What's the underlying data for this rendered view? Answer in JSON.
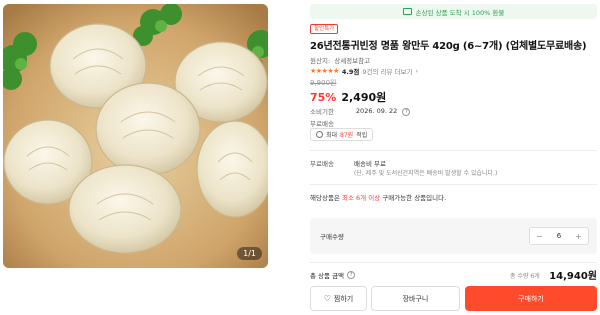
{
  "image": {
    "counter": "1/1"
  },
  "banner": {
    "text": "손상된 상품 도착 시 100% 환불",
    "color": "#2f9f52"
  },
  "product": {
    "badge": "할인특가",
    "title": "26년전통귀빈정 명품 왕만두 420g (6~7개) (업체별도무료배송)",
    "origin_label": "원산지:",
    "origin_value": "상세정보참고",
    "rating": {
      "stars": "★★★★★",
      "score": "4.9점",
      "reviews": "9건의 리뷰 더보기",
      "chevron": "›"
    },
    "original_price": "9,900원",
    "discount": "75%",
    "price": "2,490원",
    "expiry_label": "소비기한",
    "expiry_value": "2026. 09. 22",
    "help_symbol": "?"
  },
  "benefit": {
    "label": "무료배송",
    "coupon_prefix": "최대",
    "coupon_highlight": "87원",
    "coupon_suffix": "적립"
  },
  "shipping": {
    "label": "무료배송",
    "value": "배송비 무료",
    "note": "(단, 제주 및 도서산간지역은 배송비 발생할 수 있습니다.)"
  },
  "bundle": {
    "prefix": "해당상품은",
    "highlight": "최소 6개 이상",
    "suffix": "구매가능한 상품입니다."
  },
  "quantity": {
    "label": "구매수량",
    "value": "6",
    "minus": "−",
    "plus": "+"
  },
  "total": {
    "label": "총 상품 금액",
    "help_symbol": "?",
    "count": "총 수량 6개",
    "price": "14,940원"
  },
  "actions": {
    "wish_label": "찜하기",
    "cart_label": "장바구니",
    "buy_label": "구매하기"
  },
  "colors": {
    "accent": "#ff4a2b",
    "discount": "#ff3b2c",
    "star": "#ff7a1f"
  }
}
